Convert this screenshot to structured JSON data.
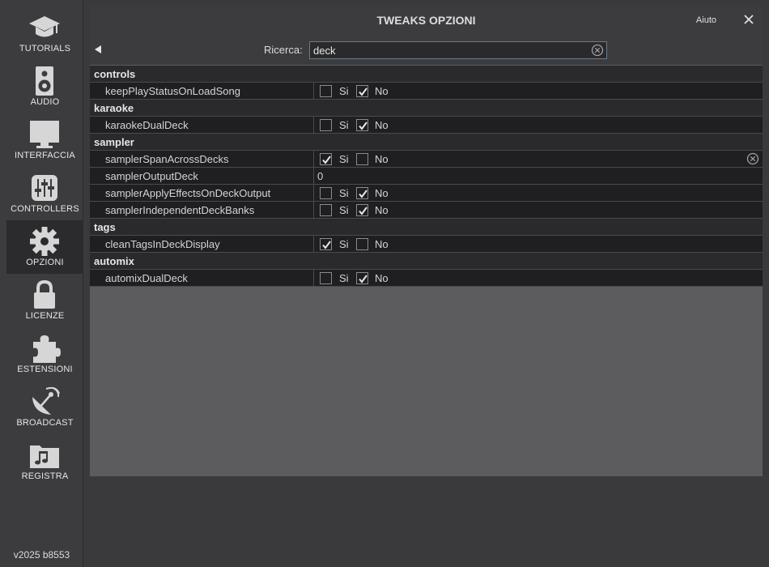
{
  "sidebar": {
    "items": [
      {
        "label": "TUTORIALS",
        "icon": "graduation-cap-icon"
      },
      {
        "label": "AUDIO",
        "icon": "speaker-icon"
      },
      {
        "label": "INTERFACCIA",
        "icon": "monitor-icon"
      },
      {
        "label": "CONTROLLERS",
        "icon": "sliders-icon"
      },
      {
        "label": "OPZIONI",
        "icon": "gear-icon",
        "active": true
      },
      {
        "label": "LICENZE",
        "icon": "lock-icon"
      },
      {
        "label": "ESTENSIONI",
        "icon": "puzzle-icon"
      },
      {
        "label": "BROADCAST",
        "icon": "satellite-dish-icon"
      },
      {
        "label": "REGISTRA",
        "icon": "music-folder-icon"
      }
    ],
    "version": "v2025 b8553"
  },
  "window": {
    "title": "TWEAKS OPZIONI",
    "help_label": "Aiuto"
  },
  "search": {
    "label": "Ricerca:",
    "value": "deck"
  },
  "labels": {
    "yes": "Si",
    "no": "No"
  },
  "groups": [
    {
      "name": "controls",
      "options": [
        {
          "name": "keepPlayStatusOnLoadSong",
          "value": "No"
        }
      ]
    },
    {
      "name": "karaoke",
      "options": [
        {
          "name": "karaokeDualDeck",
          "value": "No"
        }
      ]
    },
    {
      "name": "sampler",
      "options": [
        {
          "name": "samplerSpanAcrossDecks",
          "value": "Si",
          "modified": true
        },
        {
          "name": "samplerOutputDeck",
          "value": "0",
          "type": "text"
        },
        {
          "name": "samplerApplyEffectsOnDeckOutput",
          "value": "No"
        },
        {
          "name": "samplerIndependentDeckBanks",
          "value": "No"
        }
      ]
    },
    {
      "name": "tags",
      "options": [
        {
          "name": "cleanTagsInDeckDisplay",
          "value": "Si"
        }
      ]
    },
    {
      "name": "automix",
      "options": [
        {
          "name": "automixDualDeck",
          "value": "No"
        }
      ]
    }
  ],
  "colors": {
    "background": "#3a3a3d",
    "panel": "#5c5c5f",
    "row": "#1f1f21",
    "group_row": "#2a2a2c",
    "text": "#d4d4d4"
  }
}
